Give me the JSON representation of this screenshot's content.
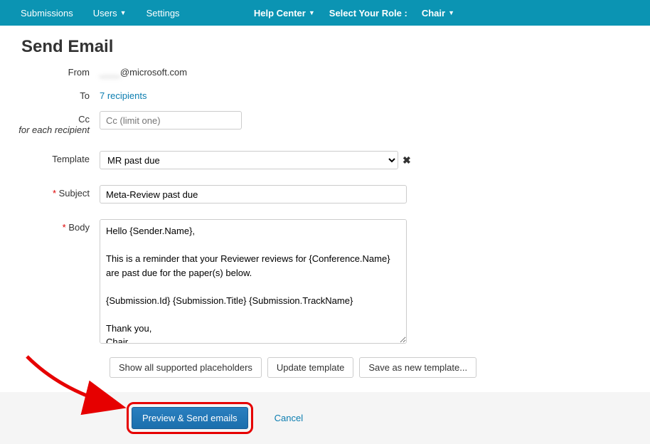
{
  "nav": {
    "submissions": "Submissions",
    "users": "Users",
    "settings": "Settings",
    "help_center": "Help Center",
    "role_label": "Select Your Role :",
    "role_value": "Chair"
  },
  "page": {
    "title": "Send Email"
  },
  "form": {
    "from_label": "From",
    "from_value_blur": "____",
    "from_value": "@microsoft.com",
    "to_label": "To",
    "to_value": "7 recipients",
    "cc_label": "Cc",
    "cc_sub": "for each recipient",
    "cc_placeholder": "Cc (limit one)",
    "template_label": "Template",
    "template_value": "MR past due",
    "subject_label": "Subject",
    "subject_value": "Meta-Review past due",
    "body_label": "Body",
    "body_value": "Hello {Sender.Name},\n\nThis is a reminder that your Reviewer reviews for {Conference.Name} are past due for the paper(s) below.\n\n{Submission.Id} {Submission.Title} {Submission.TrackName}\n\nThank you,\nChair"
  },
  "buttons": {
    "show_placeholders": "Show all supported placeholders",
    "update_template": "Update template",
    "save_as_new": "Save as new template...",
    "preview_send": "Preview & Send emails",
    "cancel": "Cancel"
  },
  "icons": {
    "remove": "✖"
  }
}
